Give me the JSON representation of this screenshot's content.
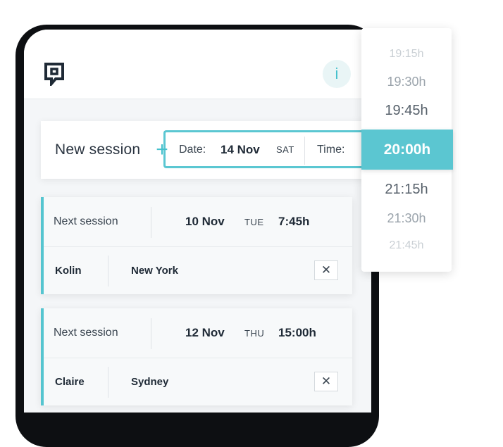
{
  "app": {
    "info_label": "i"
  },
  "new_session": {
    "title": "New session",
    "plus": "+",
    "date_label": "Date:",
    "date": "14 Nov",
    "day": "SAT",
    "time_label": "Time:"
  },
  "sessions": [
    {
      "label": "Next session",
      "date": "10 Nov",
      "day": "TUE",
      "time": "7:45h",
      "name": "Kolin",
      "city": "New York",
      "close": "✕"
    },
    {
      "label": "Next session",
      "date": "12 Nov",
      "day": "THU",
      "time": "15:00h",
      "name": "Claire",
      "city": "Sydney",
      "close": "✕"
    }
  ],
  "time_picker": {
    "options": [
      "19:15h",
      "19:30h",
      "19:45h",
      "21:15h",
      "21:30h",
      "21:45h"
    ],
    "selected": "20:00h"
  },
  "colors": {
    "accent": "#5bc6d1",
    "frame": "#0d0f12",
    "text": "#1f2a36"
  },
  "icons": {
    "logo": "logo-icon",
    "info": "info-icon",
    "close": "close-icon",
    "plus": "plus-icon"
  }
}
